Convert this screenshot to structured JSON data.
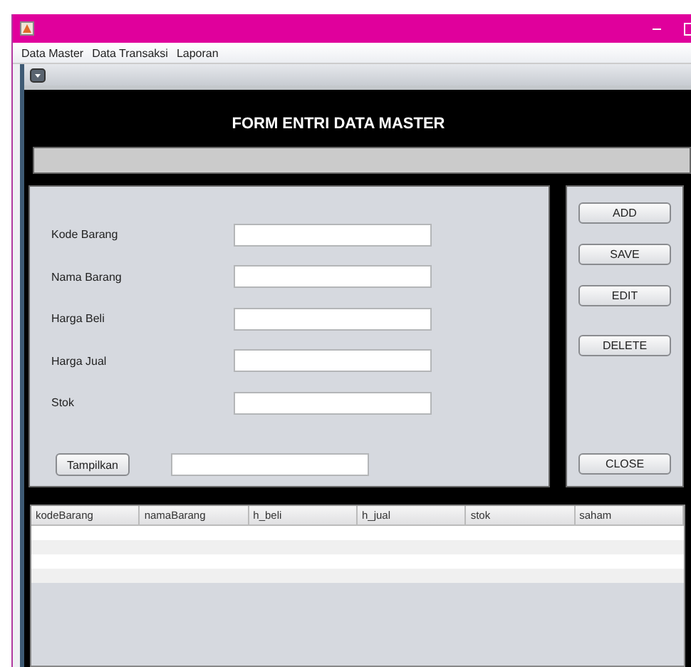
{
  "menu": [
    "Data Master",
    "Data Transaksi",
    "Laporan"
  ],
  "form": {
    "title": "FORM ENTRI DATA MASTER",
    "fields": [
      {
        "label": "Kode Barang",
        "kind": "text"
      },
      {
        "label": "Nama Barang",
        "kind": "text"
      },
      {
        "label": "Harga Beli",
        "kind": "text"
      },
      {
        "label": "Harga Jual",
        "kind": "text"
      },
      {
        "label": "Stok",
        "kind": "text"
      },
      {
        "label": "Tampilkan",
        "kind": "button"
      }
    ]
  },
  "buttons": [
    {
      "label": "ADD",
      "kind": "top"
    },
    {
      "label": "SAVE",
      "kind": "top"
    },
    {
      "label": "EDIT",
      "kind": "top"
    },
    {
      "label": "DELETE",
      "kind": "top"
    },
    {
      "label": "CLOSE",
      "kind": "bottom"
    }
  ],
  "table": {
    "columns": [
      "kodeBarang",
      "namaBarang",
      "h_beli",
      "h_jual",
      "stok",
      "saham"
    ]
  }
}
